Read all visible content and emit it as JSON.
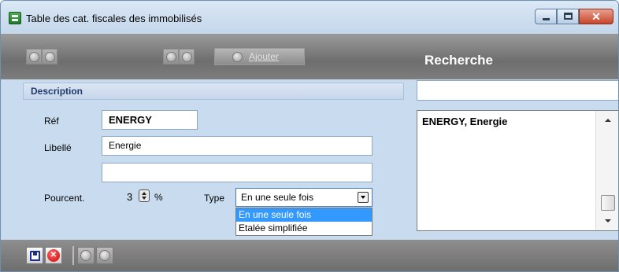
{
  "window": {
    "title": "Table des cat. fiscales des immobilisés",
    "close_glyph": "✕"
  },
  "toolbar": {
    "add_label": "Ajouter",
    "search_title": "Recherche"
  },
  "description": {
    "header": "Description",
    "ref_label": "Réf",
    "ref_value": "ENERGY",
    "libelle_label": "Libellé",
    "libelle_value": "Energie",
    "libelle2_value": "",
    "pourcent_label": "Pourcent.",
    "pourcent_value": "3",
    "pourcent_unit": "%",
    "type_label": "Type",
    "type_value": "En une seule fois",
    "type_options": [
      "En une seule fois",
      "Etalée simplifiée"
    ]
  },
  "search": {
    "query": "",
    "results": [
      "ENERGY, Energie"
    ]
  },
  "bottombar": {
    "cancel_glyph": "✕"
  },
  "colors": {
    "window_bg": "#c9dcef",
    "toolbar_bg": "#7d7d7d",
    "selection": "#3399ff",
    "header_text": "#1f3a6b"
  }
}
